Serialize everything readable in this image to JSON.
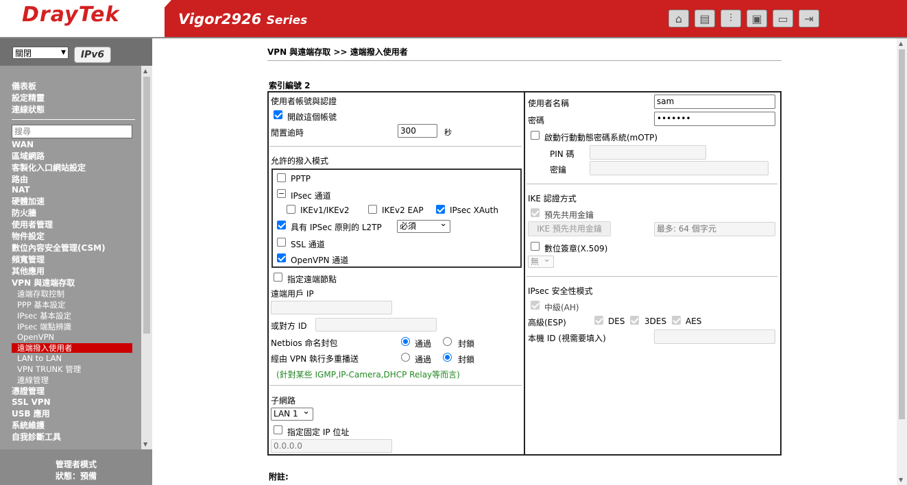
{
  "header": {
    "logo": "DrayTek",
    "model": "Vigor2926",
    "series": "Series",
    "icons": [
      "home-icon",
      "layout-icon",
      "sliders-icon",
      "save-icon",
      "book-icon",
      "logout-icon"
    ]
  },
  "sidebar": {
    "language": "關閉",
    "ipv6_badge": "IPv6",
    "top_items": [
      "儀表板",
      "設定精靈",
      "連線狀態"
    ],
    "search_placeholder": "搜尋",
    "items": [
      "WAN",
      "區域網路",
      "客製化入口網站設定",
      "路由",
      "NAT",
      "硬體加速",
      "防火牆",
      "使用者管理",
      "物件設定",
      "數位內容安全管理(CSM)",
      "頻寬管理",
      "其他應用",
      "VPN 與遠端存取"
    ],
    "sub_items": [
      "遠端存取控制",
      "PPP 基本設定",
      "IPsec 基本設定",
      "IPsec 端點辨識",
      "OpenVPN",
      "遠端撥入使用者",
      "LAN to LAN",
      "VPN TRUNK 管理",
      "連線管理"
    ],
    "items_after": [
      "憑證管理",
      "SSL VPN",
      "USB 應用",
      "系統維護",
      "自我診斷工具"
    ],
    "footer_mode": "管理者模式",
    "footer_status": "狀態：預備"
  },
  "page": {
    "breadcrumb": "VPN 與遠端存取 >> 遠端撥入使用者",
    "index_label": "索引編號 2",
    "note": "附註:"
  },
  "left": {
    "account_title": "使用者帳號與認證",
    "enable_account": "開啟這個帳號",
    "idle_timeout_label": "閒置逾時",
    "idle_timeout_value": "300",
    "idle_unit": "秒",
    "dialin_title": "允許的撥入模式",
    "pptp": "PPTP",
    "ipsec_tunnel": "IPsec 通道",
    "ikev1": "IKEv1/IKEv2",
    "ikev2eap": "IKEv2 EAP",
    "ipsec_xauth": "IPsec XAuth",
    "l2tp": "具有 IPSec 原則的 L2TP",
    "l2tp_policy": "必須",
    "ssl_tunnel": "SSL 通道",
    "openvpn": "OpenVPN 通道",
    "specify_remote": "指定遠端節點",
    "remote_client_ip": "遠端用戶 IP",
    "peer_id": "或對方 ID",
    "netbios": "Netbios 命名封包",
    "multicast": "經由 VPN 執行多重播送",
    "pass": "通過",
    "block": "封鎖",
    "note_green": "(針對某些 IGMP,IP-Camera,DHCP Relay等而言)",
    "subnet_title": "子網路",
    "subnet_value": "LAN 1",
    "fixed_ip": "指定固定 IP 位址",
    "fixed_ip_value": "0.0.0.0"
  },
  "right": {
    "username_label": "使用者名稱",
    "username_value": "sam",
    "password_label": "密碼",
    "password_value": "•••••••",
    "motp": "啟動行動動態密碼系統(mOTP)",
    "pin": "PIN 碼",
    "secret": "密鑰",
    "ike_title": "IKE 認證方式",
    "psk": "預先共用金鑰",
    "ike_psk_button": "IKE 預先共用金鑰",
    "max_chars": "最多: 64 個字元",
    "digital_sig": "數位簽章(X.509)",
    "sig_select": "無",
    "ipsec_title": "IPsec 安全性模式",
    "medium": "中級(AH)",
    "high": "高級(ESP)",
    "des": "DES",
    "tdes": "3DES",
    "aes": "AES",
    "local_id": "本機 ID (視需要填入)"
  }
}
